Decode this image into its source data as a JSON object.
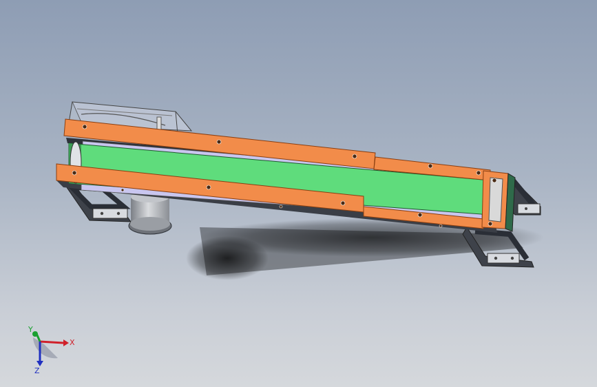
{
  "view": {
    "colors": {
      "background_top": "#8e9db4",
      "background_bottom": "#d5d8dc",
      "frame_orange": "#f28c4a",
      "frame_orange_edge": "#b85a1e",
      "belt_green": "#5fdc7c",
      "side_lavender": "#c8c4ee",
      "steel": "#c8ccd2",
      "dark_steel": "#4a4e56",
      "axis_x": "#d0202a",
      "axis_y": "#1aa030",
      "axis_z": "#2030c0"
    }
  },
  "triad": {
    "x_label": "X",
    "y_label": "Y",
    "z_label": "Z"
  }
}
